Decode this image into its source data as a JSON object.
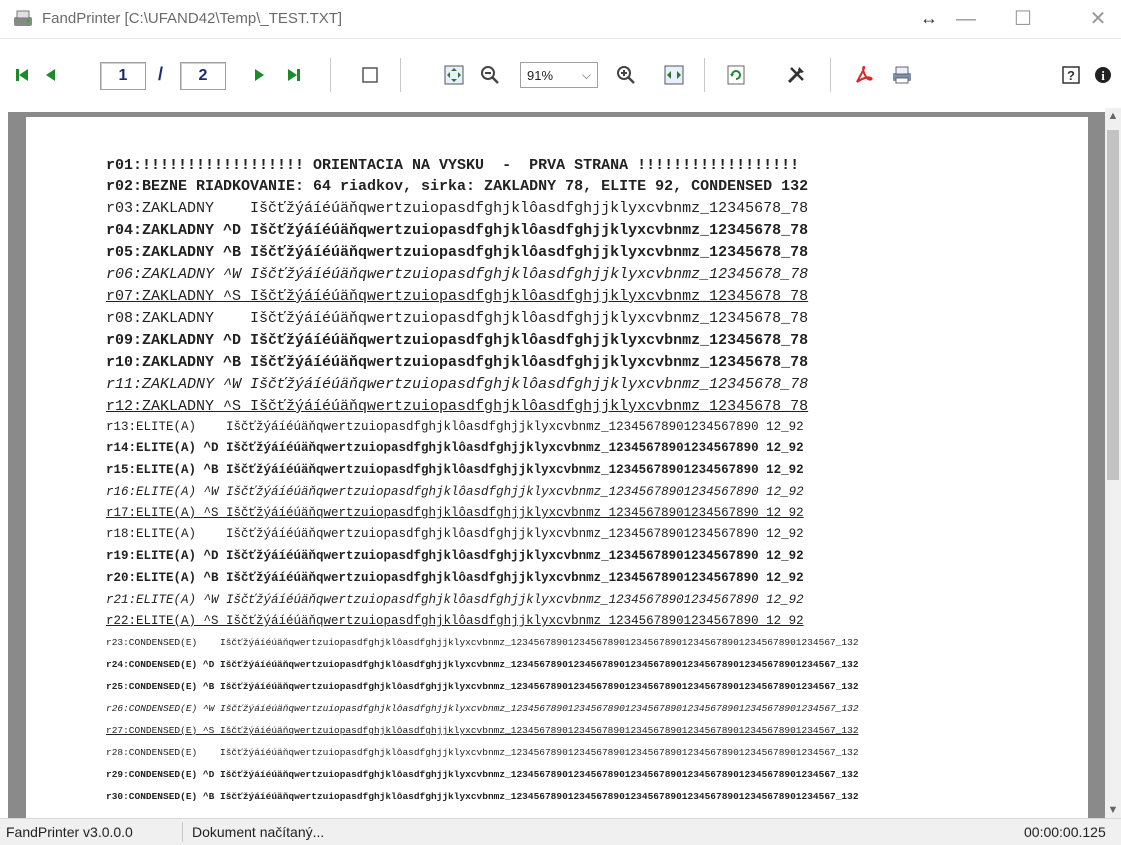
{
  "window": {
    "title": "FandPrinter [C:\\UFAND42\\Temp\\_TEST.TXT]",
    "resize_glyph": "↔",
    "minimize_glyph": "—",
    "maximize_glyph": "☐",
    "close_glyph": "✕"
  },
  "toolbar": {
    "first_page_icon": "first-page-icon",
    "prev_page_icon": "prev-page-icon",
    "current_page": "1",
    "page_separator": "/",
    "total_pages": "2",
    "next_page_icon": "next-page-icon",
    "last_page_icon": "last-page-icon",
    "page_view_icon": "page-view-icon",
    "fit_page_icon": "fit-page-icon",
    "zoom_out_icon": "zoom-out-icon",
    "zoom_value": "91%",
    "zoom_in_icon": "zoom-in-icon",
    "fit_width_icon": "fit-width-icon",
    "refresh_icon": "refresh-icon",
    "settings_icon": "tools-icon",
    "pdf_icon": "pdf-icon",
    "print_icon": "print-icon",
    "help_icon": "help-icon",
    "info_icon": "info-icon",
    "colors": {
      "nav_green": "#1a8a2a",
      "page_text": "#1a2a7a",
      "pdf_red": "#d42a2a"
    }
  },
  "document": {
    "lines": [
      {
        "text": "r01:!!!!!!!!!!!!!!!!!! ORIENTACIA NA VYSKU  -  PRVA STRANA !!!!!!!!!!!!!!!!!!",
        "style": "b"
      },
      {
        "text": "r02:BEZNE RIADKOVANIE: 64 riadkov, sirka: ZAKLADNY 78, ELITE 92, CONDENSED 132",
        "style": "mixed"
      },
      {
        "text": "r03:ZAKLADNY    Iščťžýáíéúäňqwertzuiopasdfghjklôasdfghjjklyxcvbnmz_12345678_78",
        "style": ""
      },
      {
        "text": "r04:ZAKLADNY ^D Iščťžýáíéúäňqwertzuiopasdfghjklôasdfghjjklyxcvbnmz_12345678_78",
        "style": "b"
      },
      {
        "text": "r05:ZAKLADNY ^B Iščťžýáíéúäňqwertzuiopasdfghjklôasdfghjjklyxcvbnmz_12345678_78",
        "style": "b"
      },
      {
        "text": "r06:ZAKLADNY ^W Iščťžýáíéúäňqwertzuiopasdfghjklôasdfghjjklyxcvbnmz_12345678_78",
        "style": "i"
      },
      {
        "text": "r07:ZAKLADNY ^S Iščťžýáíéúäňqwertzuiopasdfghjklôasdfghjjklyxcvbnmz_12345678_78",
        "style": "u"
      },
      {
        "text": "r08:ZAKLADNY    Iščťžýáíéúäňqwertzuiopasdfghjklôasdfghjjklyxcvbnmz_12345678_78",
        "style": ""
      },
      {
        "text": "r09:ZAKLADNY ^D Iščťžýáíéúäňqwertzuiopasdfghjklôasdfghjjklyxcvbnmz_12345678_78",
        "style": "b"
      },
      {
        "text": "r10:ZAKLADNY ^B Iščťžýáíéúäňqwertzuiopasdfghjklôasdfghjjklyxcvbnmz_12345678_78",
        "style": "b"
      },
      {
        "text": "r11:ZAKLADNY ^W Iščťžýáíéúäňqwertzuiopasdfghjklôasdfghjjklyxcvbnmz_12345678_78",
        "style": "i"
      },
      {
        "text": "r12:ZAKLADNY ^S Iščťžýáíéúäňqwertzuiopasdfghjklôasdfghjjklyxcvbnmz_12345678_78",
        "style": "u"
      },
      {
        "text": "r13:ELITE(A)    Iščťžýáíéúäňqwertzuiopasdfghjklôasdfghjjklyxcvbnmz_12345678901234567890 12_92",
        "style": "sm"
      },
      {
        "text": "r14:ELITE(A) ^D Iščťžýáíéúäňqwertzuiopasdfghjklôasdfghjjklyxcvbnmz_12345678901234567890 12_92",
        "style": "sm b"
      },
      {
        "text": "r15:ELITE(A) ^B Iščťžýáíéúäňqwertzuiopasdfghjklôasdfghjjklyxcvbnmz_12345678901234567890 12_92",
        "style": "sm b"
      },
      {
        "text": "r16:ELITE(A) ^W Iščťžýáíéúäňqwertzuiopasdfghjklôasdfghjjklyxcvbnmz_12345678901234567890 12_92",
        "style": "sm i"
      },
      {
        "text": "r17:ELITE(A) ^S Iščťžýáíéúäňqwertzuiopasdfghjklôasdfghjjklyxcvbnmz_12345678901234567890 12_92",
        "style": "sm u"
      },
      {
        "text": "r18:ELITE(A)    Iščťžýáíéúäňqwertzuiopasdfghjklôasdfghjjklyxcvbnmz_12345678901234567890 12_92",
        "style": "sm"
      },
      {
        "text": "r19:ELITE(A) ^D Iščťžýáíéúäňqwertzuiopasdfghjklôasdfghjjklyxcvbnmz_12345678901234567890 12_92",
        "style": "sm b"
      },
      {
        "text": "r20:ELITE(A) ^B Iščťžýáíéúäňqwertzuiopasdfghjklôasdfghjjklyxcvbnmz_12345678901234567890 12_92",
        "style": "sm b"
      },
      {
        "text": "r21:ELITE(A) ^W Iščťžýáíéúäňqwertzuiopasdfghjklôasdfghjjklyxcvbnmz_12345678901234567890 12_92",
        "style": "sm i"
      },
      {
        "text": "r22:ELITE(A) ^S Iščťžýáíéúäňqwertzuiopasdfghjklôasdfghjjklyxcvbnmz_12345678901234567890 12_92",
        "style": "sm u"
      },
      {
        "text": "r23:CONDENSED(E)    Iščťžýáíéúäňqwertzuiopasdfghjklôasdfghjjklyxcvbnmz_123456789012345678901234567890123456789012345678901234567_132",
        "style": "xs"
      },
      {
        "text": "r24:CONDENSED(E) ^D Iščťžýáíéúäňqwertzuiopasdfghjklôasdfghjjklyxcvbnmz_123456789012345678901234567890123456789012345678901234567_132",
        "style": "xs b"
      },
      {
        "text": "r25:CONDENSED(E) ^B Iščťžýáíéúäňqwertzuiopasdfghjklôasdfghjjklyxcvbnmz_123456789012345678901234567890123456789012345678901234567_132",
        "style": "xs b"
      },
      {
        "text": "r26:CONDENSED(E) ^W Iščťžýáíéúäňqwertzuiopasdfghjklôasdfghjjklyxcvbnmz_123456789012345678901234567890123456789012345678901234567_132",
        "style": "xs i"
      },
      {
        "text": "r27:CONDENSED(E) ^S Iščťžýáíéúäňqwertzuiopasdfghjklôasdfghjjklyxcvbnmz_123456789012345678901234567890123456789012345678901234567_132",
        "style": "xs u"
      },
      {
        "text": "r28:CONDENSED(E)    Iščťžýáíéúäňqwertzuiopasdfghjklôasdfghjjklyxcvbnmz_123456789012345678901234567890123456789012345678901234567_132",
        "style": "xs"
      },
      {
        "text": "r29:CONDENSED(E) ^D Iščťžýáíéúäňqwertzuiopasdfghjklôasdfghjjklyxcvbnmz_123456789012345678901234567890123456789012345678901234567_132",
        "style": "xs b"
      },
      {
        "text": "r30:CONDENSED(E) ^B Iščťžýáíéúäňqwertzuiopasdfghjklôasdfghjjklyxcvbnmz_123456789012345678901234567890123456789012345678901234567_132",
        "style": "xs b"
      }
    ]
  },
  "status": {
    "version": "FandPrinter v3.0.0.0",
    "message": "Dokument načítaný...",
    "elapsed": "00:00:00.125"
  }
}
